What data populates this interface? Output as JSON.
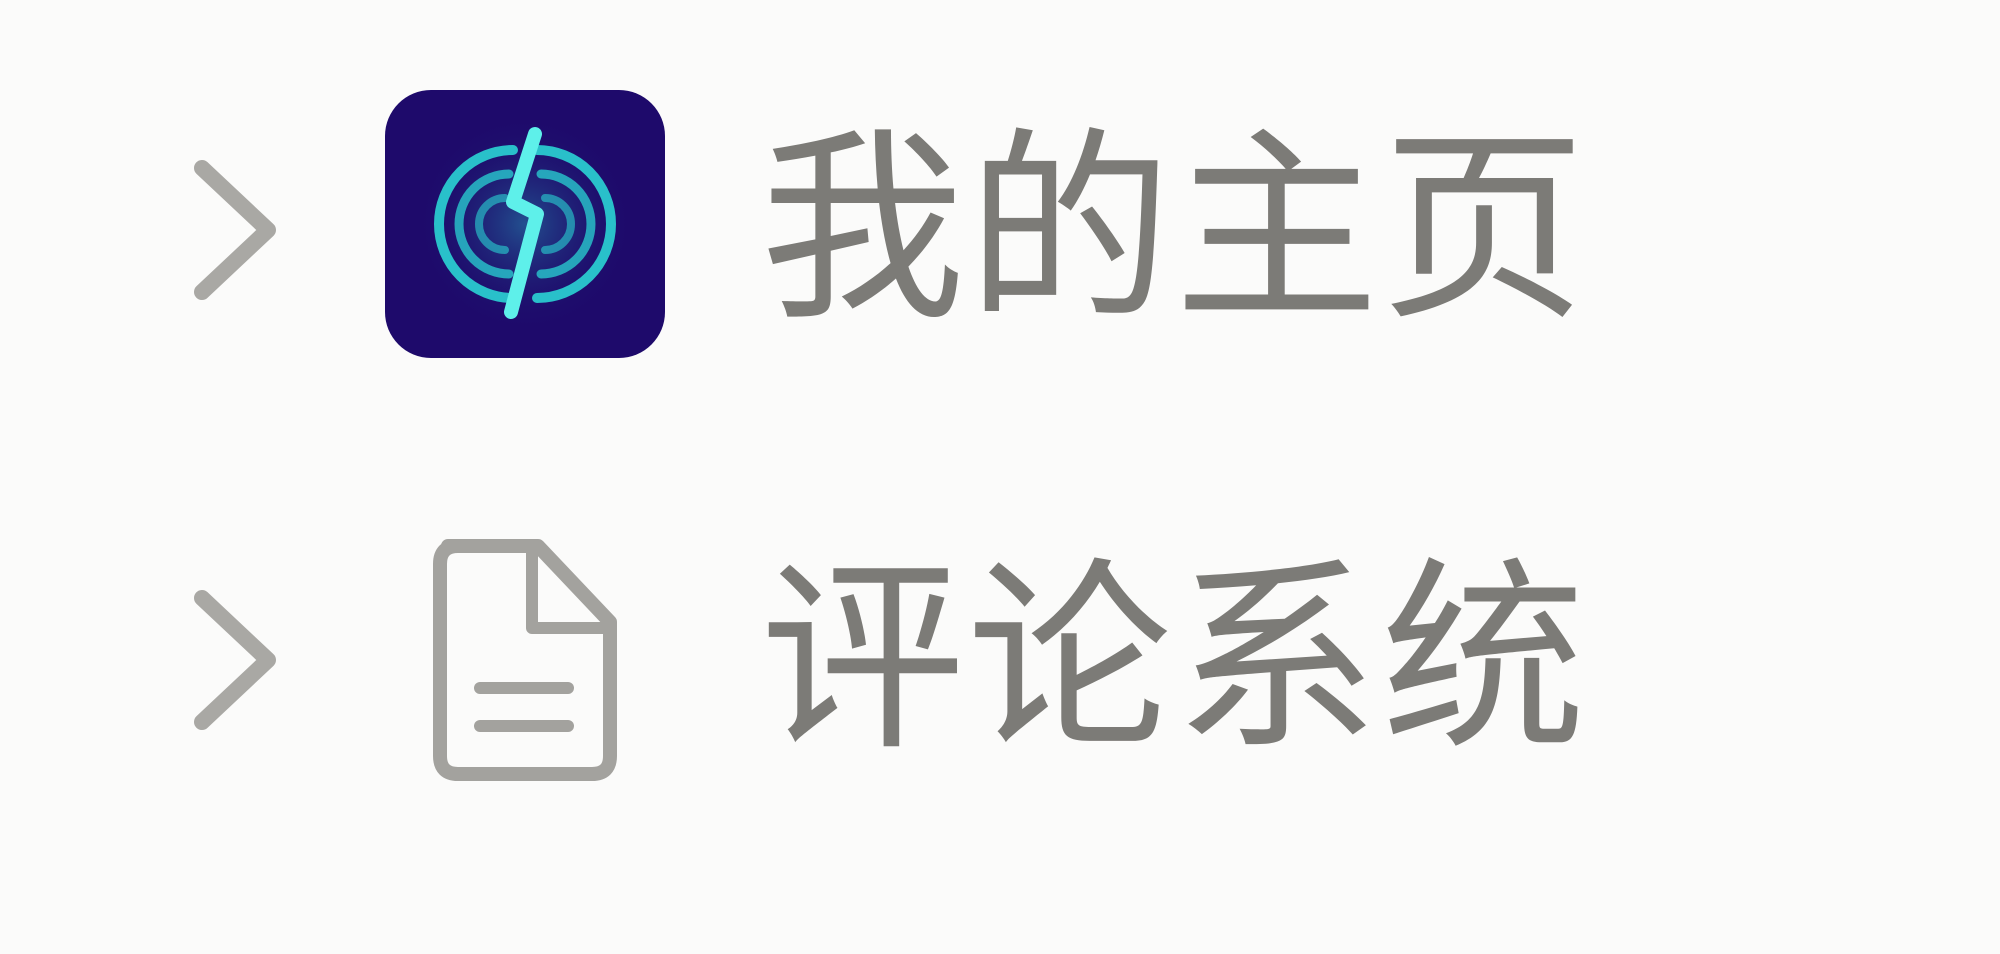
{
  "sidebar": {
    "items": [
      {
        "label": "我的主页",
        "icon": "homepage-logo-icon",
        "expand_icon": "chevron-right-icon"
      },
      {
        "label": "评论系统",
        "icon": "document-icon",
        "expand_icon": "chevron-right-icon"
      }
    ]
  },
  "colors": {
    "background": "#fbfbfa",
    "text": "#7c7b77",
    "icon_gray": "#a3a29e",
    "logo_background": "#1e0a6b",
    "logo_accent": "#2ad4d4"
  }
}
